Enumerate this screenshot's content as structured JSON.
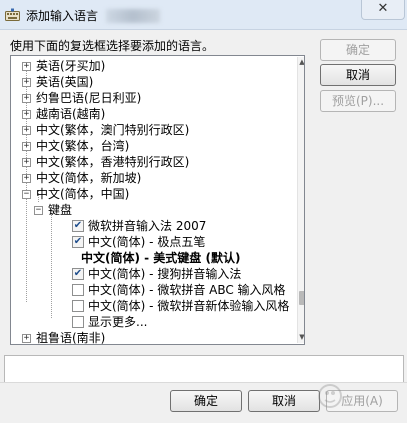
{
  "window": {
    "title": "添加输入语言",
    "close_glyph": "✕"
  },
  "instruction": "使用下面的复选框选择要添加的语言。",
  "tree": {
    "rows": [
      {
        "label": "英语(牙买加)",
        "toggle": "+"
      },
      {
        "label": "英语(英国)",
        "toggle": "+"
      },
      {
        "label": "约鲁巴语(尼日利亚)",
        "toggle": "+"
      },
      {
        "label": "越南语(越南)",
        "toggle": "+"
      },
      {
        "label": "中文(繁体，澳门特别行政区)",
        "toggle": "+"
      },
      {
        "label": "中文(繁体，台湾)",
        "toggle": "+"
      },
      {
        "label": "中文(繁体，香港特别行政区)",
        "toggle": "+"
      },
      {
        "label": "中文(简体，新加坡)",
        "toggle": "+"
      },
      {
        "label": "中文(简体，中国)",
        "toggle": "−"
      },
      {
        "label": "键盘",
        "toggle": "−"
      },
      {
        "label": "微软拼音输入法 2007",
        "checked": true
      },
      {
        "label": "中文(简体) - 极点五笔",
        "checked": true
      },
      {
        "label": "中文(简体) - 美式键盘 (默认)",
        "bold": true
      },
      {
        "label": "中文(简体) - 搜狗拼音输入法",
        "checked": true
      },
      {
        "label": "中文(简体) - 微软拼音 ABC 输入风格",
        "checked": false
      },
      {
        "label": "中文(简体) - 微软拼音新体验输入风格",
        "checked": false
      },
      {
        "label": "显示更多...",
        "checked": false
      },
      {
        "label": "祖鲁语(南非)",
        "toggle": "+"
      }
    ],
    "check_glyph": "✔"
  },
  "side_buttons": {
    "ok": "确定",
    "cancel": "取消",
    "preview": "预览(P)..."
  },
  "bottom_buttons": {
    "ok": "确定",
    "cancel": "取消",
    "apply": "应用(A)"
  },
  "colors": {
    "titlebar": "#dfe9f5",
    "dialog_bg": "#f0f0f0",
    "check": "#1f4e8c"
  }
}
